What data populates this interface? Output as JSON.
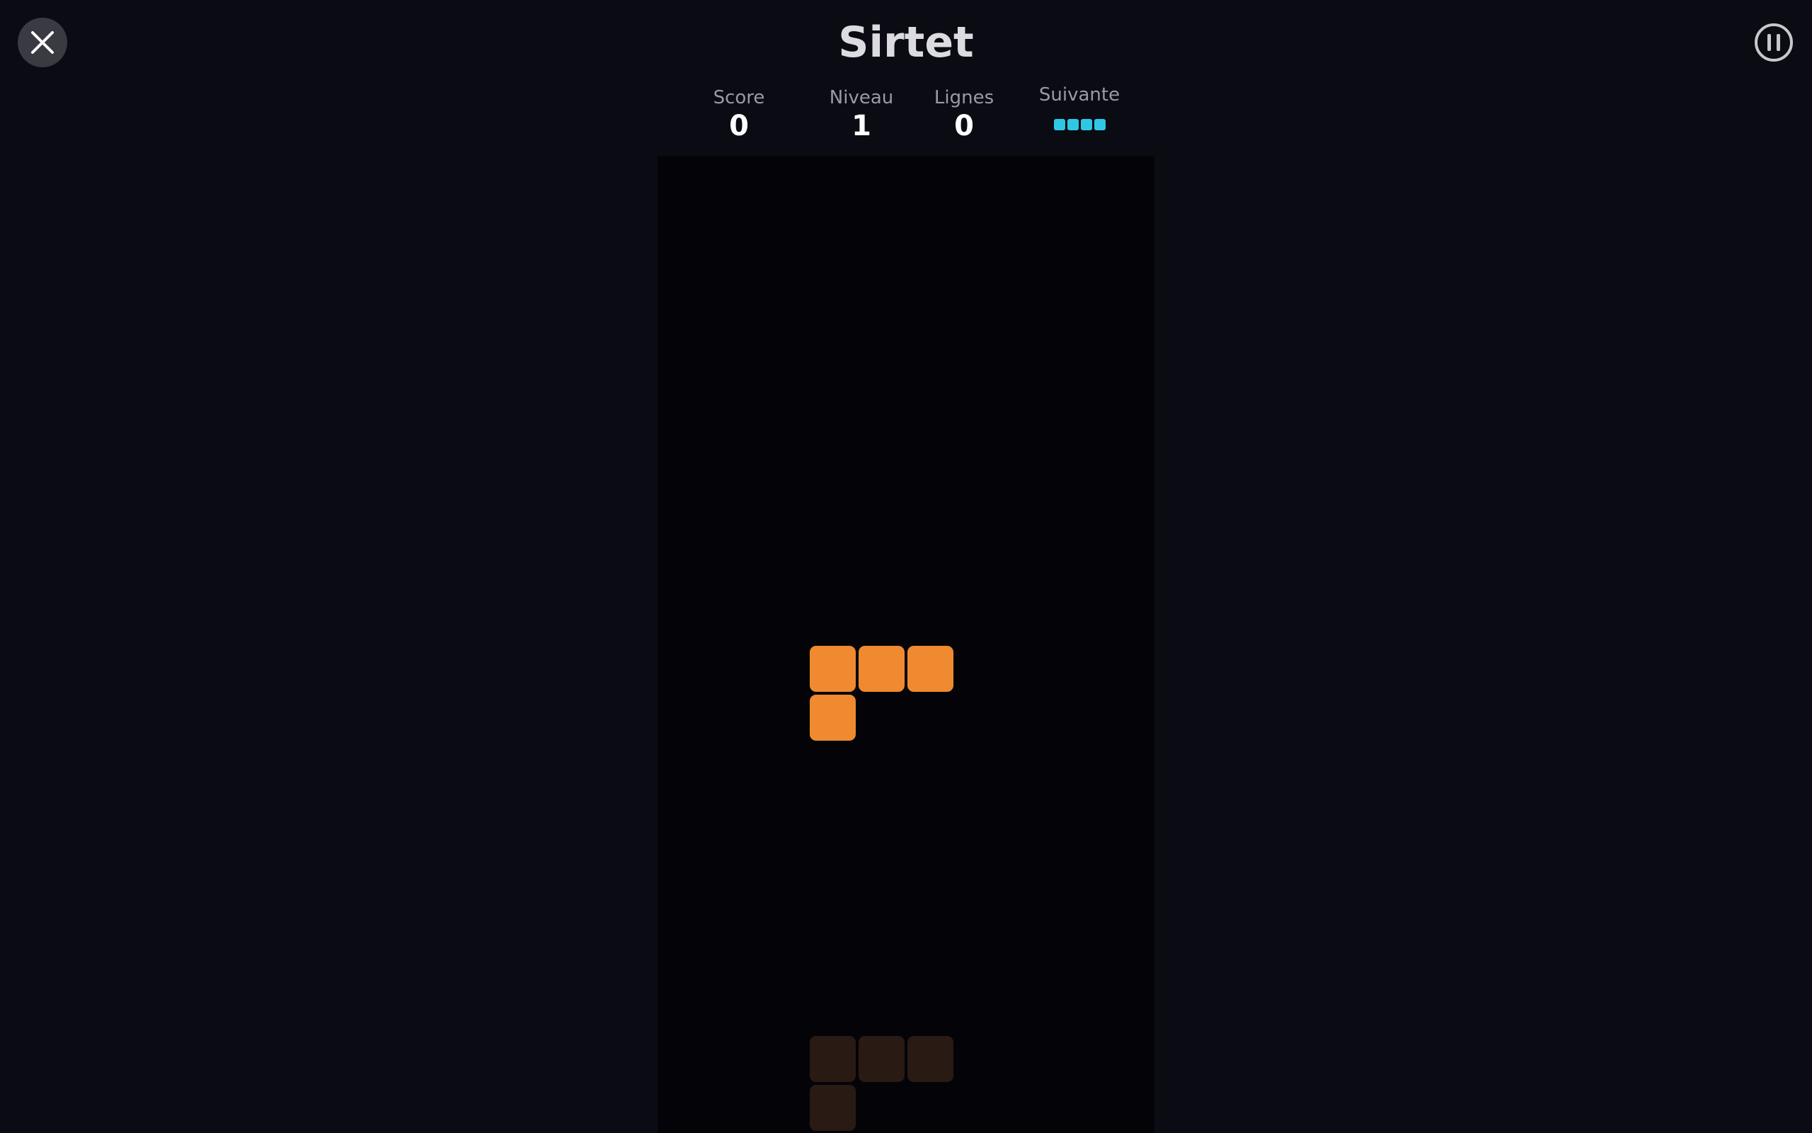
{
  "header": {
    "title": "Sirtet"
  },
  "stats": {
    "score_label": "Score",
    "score_value": "0",
    "level_label": "Niveau",
    "level_value": "1",
    "lines_label": "Lignes",
    "lines_value": "0",
    "next_label": "Suivante"
  },
  "controls": {
    "close_icon": "close-icon",
    "pause_icon": "pause-icon"
  },
  "next_piece": {
    "type": "I",
    "color": "#2ec8e6",
    "cells": 4
  },
  "active_piece": {
    "type": "L",
    "color": "#ef8a30",
    "cells": [
      [
        0,
        0
      ],
      [
        1,
        0
      ],
      [
        2,
        0
      ],
      [
        0,
        1
      ]
    ]
  },
  "ghost_piece": {
    "color": "#2a1a14",
    "cells": [
      [
        0,
        0
      ],
      [
        1,
        0
      ],
      [
        2,
        0
      ],
      [
        0,
        1
      ]
    ]
  },
  "colors": {
    "background": "#0b0b14",
    "board": "#040408",
    "title": "#dcdce0"
  }
}
